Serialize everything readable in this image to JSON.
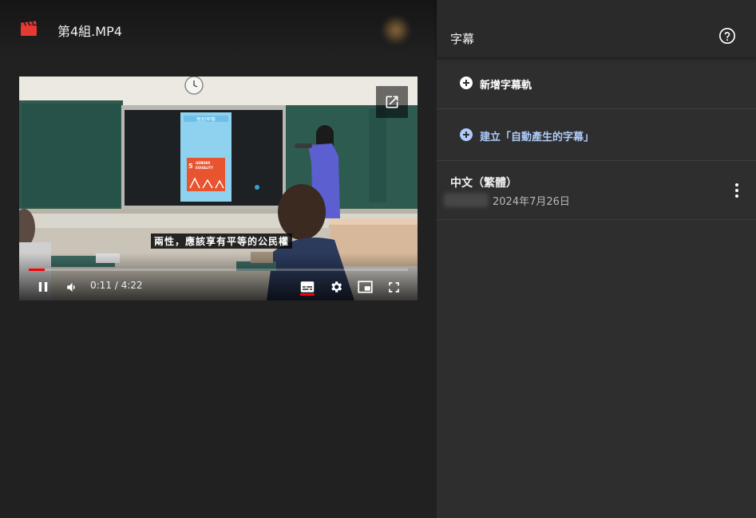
{
  "header": {
    "file_title": "第4組.MP4"
  },
  "player": {
    "caption_text": "兩性，應該享有平等的公民權",
    "current_time": "0:11",
    "duration": "4:22",
    "time_display": "0:11 / 4:22",
    "progress_fraction": 0.042,
    "captions_enabled": true,
    "slide": {
      "title": "性別平等",
      "number": "5",
      "heading_line1": "GENDER",
      "heading_line2": "EQUALITY"
    }
  },
  "panel": {
    "title": "字幕",
    "actions": [
      {
        "label": "新增字幕軌",
        "color": "#ffffff"
      },
      {
        "label": "建立「自動產生的字幕」",
        "color": "#aecbfa"
      }
    ],
    "tracks": [
      {
        "language": "中文（繁體）",
        "date": "2024年7月26日"
      }
    ]
  },
  "colors": {
    "accent_red": "#ff0000",
    "link_blue": "#aecbfa",
    "panel_bg": "#2e2e2e",
    "page_bg": "#212121"
  },
  "icons": {
    "file": "clapperboard-icon",
    "help": "help-circle-icon",
    "add": "add-circle-icon",
    "more": "more-vert-icon"
  }
}
